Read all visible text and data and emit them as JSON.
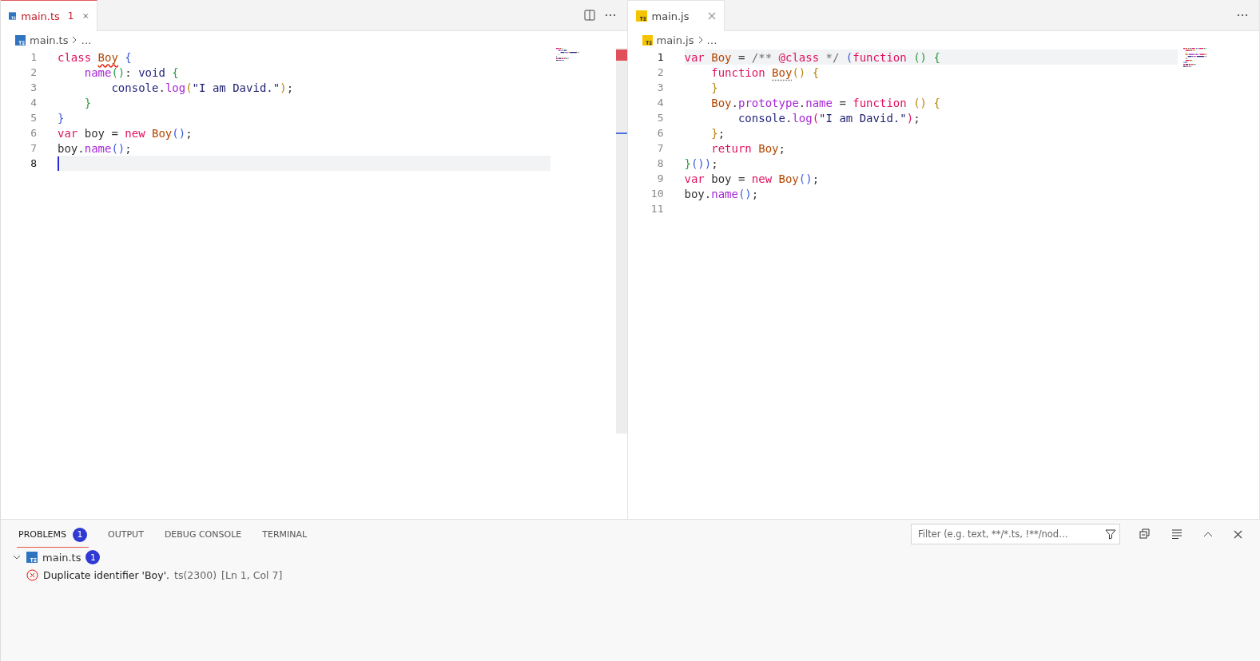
{
  "editors": [
    {
      "tab": {
        "label": "main.ts",
        "kind": "typescript",
        "problem_count": "1",
        "error": true,
        "selected": true
      },
      "breadcrumb": {
        "kind": "typescript",
        "file": "main.ts",
        "rest": "…"
      },
      "split_action": true,
      "lines": [
        {
          "number": "1",
          "current": false,
          "tokens": [
            {
              "text": "class ",
              "kind": "keyword"
            },
            {
              "text": "Boy",
              "kind": "class-error"
            },
            {
              "text": " {",
              "kind": "bracket1"
            }
          ]
        },
        {
          "number": "2",
          "current": false,
          "tokens": [
            {
              "text": "    name",
              "kind": "function"
            },
            {
              "text": "()",
              "kind": "bracket2"
            },
            {
              "text": ": "
            },
            {
              "text": "void ",
              "kind": "variable"
            },
            {
              "text": "{",
              "kind": "bracket2"
            }
          ]
        },
        {
          "number": "3",
          "current": false,
          "tokens": [
            {
              "text": "        console",
              "kind": "variable"
            },
            {
              "text": "."
            },
            {
              "text": "log",
              "kind": "function"
            },
            {
              "text": "(",
              "kind": "bracket3"
            },
            {
              "text": "\"I am David.\"",
              "kind": "string"
            },
            {
              "text": ")",
              "kind": "bracket3"
            },
            {
              "text": ";"
            }
          ]
        },
        {
          "number": "4",
          "current": false,
          "tokens": [
            {
              "text": "    }",
              "kind": "bracket2"
            }
          ]
        },
        {
          "number": "5",
          "current": false,
          "tokens": [
            {
              "text": "}",
              "kind": "bracket1"
            }
          ]
        },
        {
          "number": "6",
          "current": false,
          "tokens": [
            {
              "text": "var ",
              "kind": "keyword"
            },
            {
              "text": "boy = "
            },
            {
              "text": "new ",
              "kind": "keyword"
            },
            {
              "text": "Boy",
              "kind": "class"
            },
            {
              "text": "()",
              "kind": "bracket1"
            },
            {
              "text": ";"
            }
          ]
        },
        {
          "number": "7",
          "current": false,
          "tokens": [
            {
              "text": "boy."
            },
            {
              "text": "name",
              "kind": "function"
            },
            {
              "text": "()",
              "kind": "bracket1"
            },
            {
              "text": ";"
            }
          ]
        },
        {
          "number": "8",
          "current": true
        }
      ]
    },
    {
      "tab": {
        "label": "main.js",
        "kind": "javascript",
        "error": false,
        "selected": true
      },
      "breadcrumb": {
        "kind": "javascript",
        "file": "main.js",
        "rest": "…"
      },
      "lines": [
        {
          "number": "1",
          "current": true,
          "tokens": [
            {
              "text": "var ",
              "kind": "keyword"
            },
            {
              "text": "Boy",
              "kind": "class"
            },
            {
              "text": " = "
            },
            {
              "text": "/** ",
              "kind": "comment"
            },
            {
              "text": "@class",
              "kind": "keyword"
            },
            {
              "text": " */ ",
              "kind": "comment"
            },
            {
              "text": "(",
              "kind": "bracket1"
            },
            {
              "text": "function ",
              "kind": "keyword"
            },
            {
              "text": "() ",
              "kind": "bracket2"
            },
            {
              "text": "{",
              "kind": "bracket2"
            }
          ]
        },
        {
          "number": "2",
          "current": false,
          "tokens": [
            {
              "text": "    function ",
              "kind": "keyword"
            },
            {
              "text": "Boy",
              "kind": "class-hint"
            },
            {
              "text": "() ",
              "kind": "bracket3"
            },
            {
              "text": "{",
              "kind": "bracket3"
            }
          ]
        },
        {
          "number": "3",
          "current": false,
          "tokens": [
            {
              "text": "    }",
              "kind": "bracket3"
            }
          ]
        },
        {
          "number": "4",
          "current": false,
          "tokens": [
            {
              "text": "    Boy",
              "kind": "class"
            },
            {
              "text": "."
            },
            {
              "text": "prototype",
              "kind": "function"
            },
            {
              "text": "."
            },
            {
              "text": "name",
              "kind": "function"
            },
            {
              "text": " = "
            },
            {
              "text": "function ",
              "kind": "keyword"
            },
            {
              "text": "() ",
              "kind": "bracket3"
            },
            {
              "text": "{",
              "kind": "bracket3"
            }
          ]
        },
        {
          "number": "5",
          "current": false,
          "tokens": [
            {
              "text": "        console",
              "kind": "variable"
            },
            {
              "text": "."
            },
            {
              "text": "log",
              "kind": "function"
            },
            {
              "text": "(",
              "kind": "keyword"
            },
            {
              "text": "\"I am David.\"",
              "kind": "string"
            },
            {
              "text": ")",
              "kind": "keyword"
            },
            {
              "text": ";"
            }
          ]
        },
        {
          "number": "6",
          "current": false,
          "tokens": [
            {
              "text": "    }",
              "kind": "bracket3"
            },
            {
              "text": ";"
            }
          ]
        },
        {
          "number": "7",
          "current": false,
          "tokens": [
            {
              "text": "    return ",
              "kind": "keyword"
            },
            {
              "text": "Boy",
              "kind": "class"
            },
            {
              "text": ";"
            }
          ]
        },
        {
          "number": "8",
          "current": false,
          "tokens": [
            {
              "text": "}",
              "kind": "bracket2"
            },
            {
              "text": "())",
              "kind": "bracket1"
            },
            {
              "text": ";"
            }
          ]
        },
        {
          "number": "9",
          "current": false,
          "tokens": [
            {
              "text": "var ",
              "kind": "keyword"
            },
            {
              "text": "boy = "
            },
            {
              "text": "new ",
              "kind": "keyword"
            },
            {
              "text": "Boy",
              "kind": "class"
            },
            {
              "text": "()",
              "kind": "bracket1"
            },
            {
              "text": ";"
            }
          ]
        },
        {
          "number": "10",
          "current": false,
          "tokens": [
            {
              "text": "boy."
            },
            {
              "text": "name",
              "kind": "function"
            },
            {
              "text": "()",
              "kind": "bracket1"
            },
            {
              "text": ";"
            }
          ]
        },
        {
          "number": "11",
          "current": false
        }
      ]
    }
  ],
  "panel": {
    "tabs": [
      {
        "label": "PROBLEMS",
        "badge": "1",
        "selected": true
      },
      {
        "label": "OUTPUT",
        "selected": false
      },
      {
        "label": "DEBUG CONSOLE",
        "selected": false
      },
      {
        "label": "TERMINAL",
        "selected": false
      }
    ],
    "filter": {
      "placeholder": "Filter (e.g. text, **/*.ts, !**/nod…"
    },
    "problems": [
      {
        "file": "main.ts",
        "kind": "typescript",
        "count": "1",
        "expanded": true,
        "children": [
          {
            "message": "Duplicate identifier 'Boy'.",
            "code": "ts(2300)",
            "location": "[Ln 1, Col 7]"
          }
        ]
      }
    ]
  }
}
